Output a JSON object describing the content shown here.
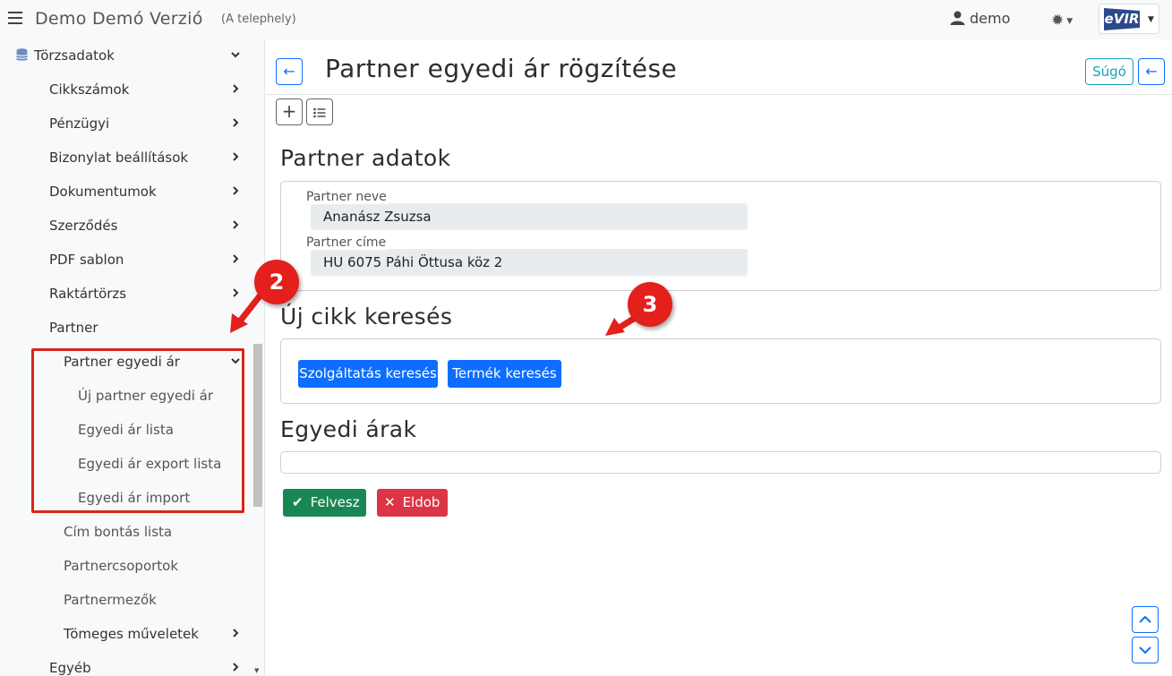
{
  "app": {
    "title": "Demo Demó Verzió",
    "subtitle": "(A telephely)",
    "user": "demo",
    "logo": "eVIR"
  },
  "sidebar": {
    "items": [
      {
        "label": "Törzsadatok",
        "icon": "database-icon",
        "chevron": "down"
      },
      {
        "label": "Cikkszámok",
        "chevron": "right"
      },
      {
        "label": "Pénzügyi",
        "chevron": "right"
      },
      {
        "label": "Bizonylat beállítások",
        "chevron": "right"
      },
      {
        "label": "Dokumentumok",
        "chevron": "right"
      },
      {
        "label": "Szerződés",
        "chevron": "right"
      },
      {
        "label": "PDF sablon",
        "chevron": "right"
      },
      {
        "label": "Raktártörzs",
        "chevron": "right"
      },
      {
        "label": "Partner",
        "chevron": "down"
      },
      {
        "label": "Partner egyedi ár",
        "chevron": "down"
      },
      {
        "label": "Új partner egyedi ár"
      },
      {
        "label": "Egyedi ár lista"
      },
      {
        "label": "Egyedi ár export lista"
      },
      {
        "label": "Egyedi ár import"
      },
      {
        "label": "Cím bontás lista"
      },
      {
        "label": "Partnercsoportok"
      },
      {
        "label": "Partnermezők"
      },
      {
        "label": "Tömeges műveletek",
        "chevron": "right"
      },
      {
        "label": "Egyéb",
        "chevron": "right"
      }
    ]
  },
  "page": {
    "title": "Partner egyedi ár rögzítése",
    "help_label": "Súgó",
    "partner_section": "Partner adatok",
    "partner_name_label": "Partner neve",
    "partner_name_value": "Ananász Zsuzsa",
    "partner_address_label": "Partner címe",
    "partner_address_value": "HU 6075 Páhi Öttusa köz 2",
    "search_section": "Új cikk keresés",
    "service_search_label": "Szolgáltatás keresés",
    "product_search_label": "Termék keresés",
    "prices_section": "Egyedi árak",
    "save_label": "Felvesz",
    "discard_label": "Eldob"
  },
  "markers": [
    "2",
    "3"
  ],
  "colors": {
    "primary": "#0d6efd",
    "success": "#198754",
    "danger": "#dc3545",
    "info": "#17a2b8",
    "annotation": "#e3201b"
  }
}
